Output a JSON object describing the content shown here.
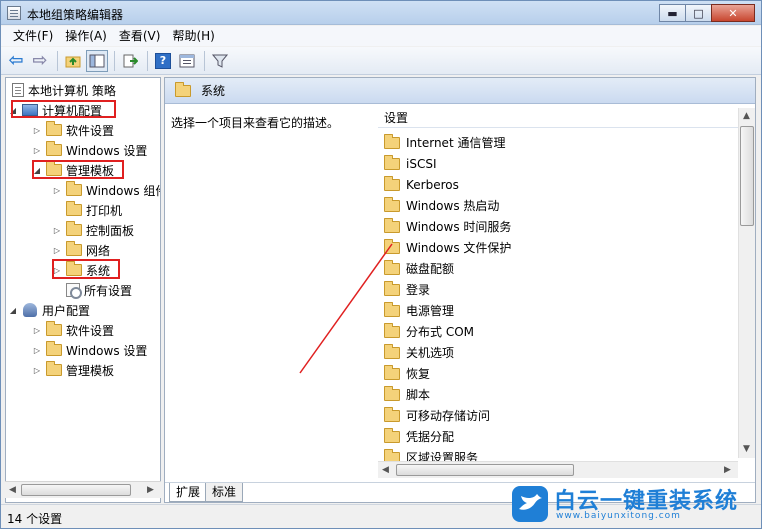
{
  "window": {
    "title": "本地组策略编辑器",
    "minimize": "▬",
    "maximize": "□",
    "close": "✕"
  },
  "menu": [
    "文件(F)",
    "操作(A)",
    "查看(V)",
    "帮助(H)"
  ],
  "tree": {
    "root": "本地计算机 策略",
    "computer_config": "计算机配置",
    "software_settings": "软件设置",
    "windows_settings": "Windows 设置",
    "admin_templates": "管理模板",
    "windows_components": "Windows 组件",
    "printers": "打印机",
    "control_panel": "控制面板",
    "network": "网络",
    "system": "系统",
    "all_settings": "所有设置",
    "user_config": "用户配置",
    "user_software_settings": "软件设置",
    "user_windows_settings": "Windows 设置",
    "user_admin_templates": "管理模板"
  },
  "right": {
    "header_title": "系统",
    "description": "选择一个项目来查看它的描述。",
    "column_header": "设置",
    "items": [
      "Internet 通信管理",
      "iSCSI",
      "Kerberos",
      "Windows 热启动",
      "Windows 时间服务",
      "Windows 文件保护",
      "磁盘配额",
      "登录",
      "电源管理",
      "分布式 COM",
      "关机选项",
      "恢复",
      "脚本",
      "可移动存储访问",
      "凭据分配",
      "区域设置服务"
    ]
  },
  "tabs": {
    "extended": "扩展",
    "standard": "标准"
  },
  "status": {
    "text": "14 个设置"
  },
  "watermark": {
    "title": "白云一键重装系统",
    "url": "www.baiyunxitong.com"
  },
  "colors": {
    "highlight_box": "#e02020",
    "accent": "#1f7fd6"
  }
}
